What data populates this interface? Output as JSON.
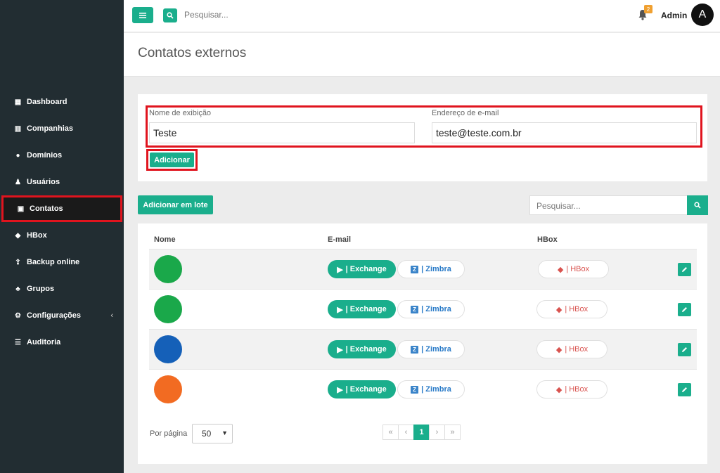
{
  "sidebar": {
    "items": [
      {
        "label": "Dashboard",
        "icon": "dashboard-icon",
        "glyph": "▦"
      },
      {
        "label": "Companhias",
        "icon": "building-icon",
        "glyph": "▥"
      },
      {
        "label": "Domínios",
        "icon": "globe-icon",
        "glyph": "●"
      },
      {
        "label": "Usuários",
        "icon": "user-icon",
        "glyph": "♟"
      },
      {
        "label": "Contatos",
        "icon": "contact-card-icon",
        "glyph": "▣"
      },
      {
        "label": "HBox",
        "icon": "cube-icon",
        "glyph": "◆"
      },
      {
        "label": "Backup online",
        "icon": "upload-icon",
        "glyph": "⇪"
      },
      {
        "label": "Grupos",
        "icon": "users-icon",
        "glyph": "♣"
      },
      {
        "label": "Configurações",
        "icon": "gear-icon",
        "glyph": "⚙"
      },
      {
        "label": "Auditoria",
        "icon": "list-icon",
        "glyph": "☰"
      }
    ],
    "active": "Contatos"
  },
  "topbar": {
    "search_placeholder": "Pesquisar...",
    "notification_count": "2",
    "admin_name": "Admin",
    "avatar_letter": "A"
  },
  "page": {
    "title": "Contatos externos"
  },
  "form": {
    "display_name_label": "Nome de exibição",
    "display_name_value": "Teste",
    "email_label": "Endereço de e-mail",
    "email_value": "teste@teste.com.br",
    "add_button": "Adicionar"
  },
  "toolbar": {
    "batch_button": "Adicionar em lote",
    "search_placeholder": "Pesquisar..."
  },
  "table": {
    "headers": {
      "name": "Nome",
      "email": "E-mail",
      "hbox": "HBox"
    },
    "rows": [
      {
        "avatar_color": "#1aa84a",
        "exchange": "| Exchange",
        "zimbra": "| Zimbra",
        "hbox": "| HBox"
      },
      {
        "avatar_color": "#1aa84a",
        "exchange": "| Exchange",
        "zimbra": "| Zimbra",
        "hbox": "| HBox"
      },
      {
        "avatar_color": "#1560b8",
        "exchange": "| Exchange",
        "zimbra": "| Zimbra",
        "hbox": "| HBox"
      },
      {
        "avatar_color": "#f26b22",
        "exchange": "| Exchange",
        "zimbra": "| Zimbra",
        "hbox": "| HBox"
      }
    ]
  },
  "pagination": {
    "per_page_label": "Por página",
    "per_page_value": "50",
    "first": "«",
    "prev": "‹",
    "current": "1",
    "next": "›",
    "last": "»"
  },
  "colors": {
    "accent": "#1aae8c",
    "sidebar": "#222d32",
    "highlight": "#e0141e"
  }
}
